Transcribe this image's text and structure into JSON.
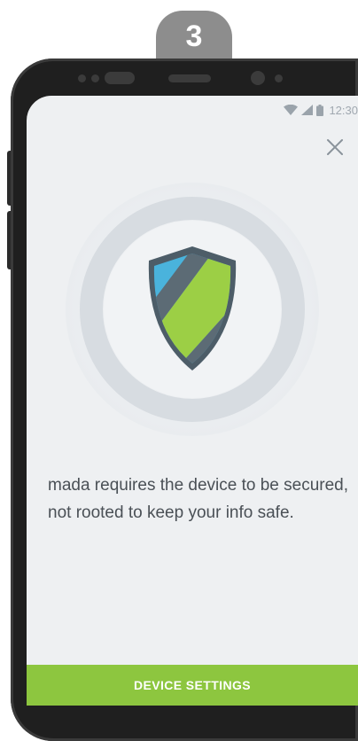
{
  "step": {
    "number": "3"
  },
  "status_bar": {
    "time": "12:30",
    "icons": [
      "wifi-icon",
      "signal-icon",
      "battery-icon"
    ]
  },
  "dialog": {
    "close_icon": "close-icon",
    "illustration_icon": "shield-icon",
    "message": "mada requires the device to be secured, not rooted to keep your info safe.",
    "primary_button_label": "DEVICE SETTINGS"
  },
  "colors": {
    "accent_green": "#8dc63f",
    "shield_blue": "#4ab3dc",
    "shield_green": "#9ccf45",
    "background": "#eef0f2",
    "badge_gray": "#8d8d8d"
  }
}
